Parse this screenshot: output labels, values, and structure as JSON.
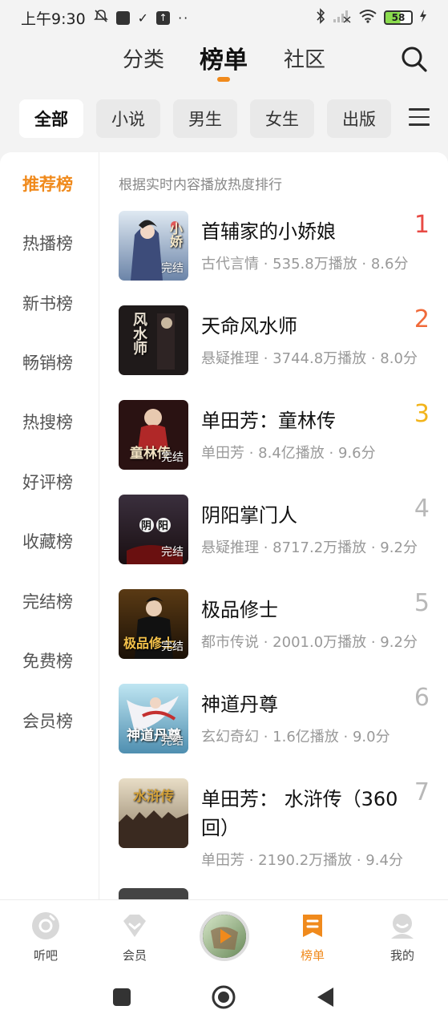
{
  "status_bar": {
    "time": "上午9:30",
    "battery": "58"
  },
  "top_nav": {
    "tabs": [
      "分类",
      "榜单",
      "社区"
    ],
    "active_tab": "榜单",
    "accent": "#f08a1c"
  },
  "filters": {
    "chips": [
      "全部",
      "小说",
      "男生",
      "女生",
      "出版"
    ],
    "active": "全部"
  },
  "side_nav": {
    "items": [
      "推荐榜",
      "热播榜",
      "新书榜",
      "畅销榜",
      "热搜榜",
      "好评榜",
      "收藏榜",
      "完结榜",
      "免费榜",
      "会员榜"
    ],
    "active": "推荐榜"
  },
  "list": {
    "subtitle": "根据实时内容播放热度排行",
    "items": [
      {
        "rank": "1",
        "title": "首辅家的小娇娘",
        "meta": "古代言情 · 535.8万播放 · 8.6分",
        "badge": "完结",
        "cover_text": "小娇"
      },
      {
        "rank": "2",
        "title": "天命风水师",
        "meta": "悬疑推理 · 3744.8万播放 · 8.0分",
        "badge": "",
        "cover_text": "风水师"
      },
      {
        "rank": "3",
        "title": "单田芳：童林传",
        "meta": "单田芳 · 8.4亿播放 · 9.6分",
        "badge": "完结",
        "cover_text": "童林传"
      },
      {
        "rank": "4",
        "title": "阴阳掌门人",
        "meta": "悬疑推理 · 8717.2万播放 · 9.2分",
        "badge": "完结",
        "cover_text": "阴阳"
      },
      {
        "rank": "5",
        "title": "极品修士",
        "meta": "都市传说 · 2001.0万播放 · 9.2分",
        "badge": "完结",
        "cover_text": "极品修士"
      },
      {
        "rank": "6",
        "title": "神道丹尊",
        "meta": "玄幻奇幻 · 1.6亿播放 · 9.0分",
        "badge": "完结",
        "cover_text": "神道丹尊"
      },
      {
        "rank": "7",
        "title": "单田芳： 水浒传（360回）",
        "meta": "单田芳 · 2190.2万播放 · 9.4分",
        "badge": "",
        "cover_text": "水浒传"
      }
    ]
  },
  "bottom_nav": {
    "items": [
      "听吧",
      "会员",
      "榜单",
      "我的"
    ],
    "active": "榜单"
  }
}
